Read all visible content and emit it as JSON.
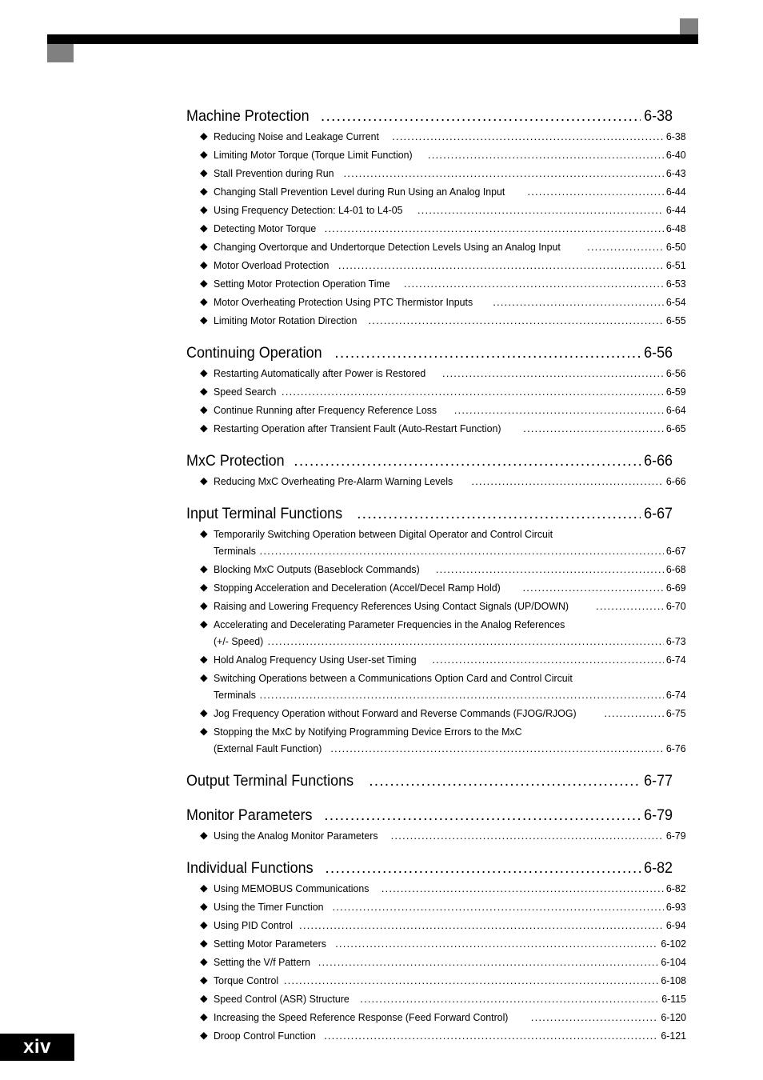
{
  "document": {
    "footer_page_label": "xiv",
    "header_bar_color": "#000000",
    "header_square_color": "#808080"
  },
  "toc": {
    "entries": [
      {
        "type": "heading",
        "title": "Machine Protection",
        "page": "6-38"
      },
      {
        "type": "item",
        "title": "Reducing Noise and Leakage Current",
        "page": "6-38"
      },
      {
        "type": "item",
        "title": "Limiting Motor Torque (Torque Limit Function)",
        "page": "6-40"
      },
      {
        "type": "item",
        "title": "Stall Prevention during Run",
        "page": "6-43"
      },
      {
        "type": "item",
        "title": "Changing Stall Prevention Level during Run Using an Analog Input",
        "page": "6-44"
      },
      {
        "type": "item",
        "title": "Using Frequency Detection: L4-01 to L4-05",
        "page": "6-44"
      },
      {
        "type": "item",
        "title": "Detecting Motor Torque",
        "page": "6-48"
      },
      {
        "type": "item",
        "title": "Changing Overtorque and Undertorque Detection Levels Using an Analog Input",
        "page": "6-50"
      },
      {
        "type": "item",
        "title": "Motor Overload Protection",
        "page": "6-51"
      },
      {
        "type": "item",
        "title": "Setting Motor Protection Operation Time",
        "page": "6-53"
      },
      {
        "type": "item",
        "title": "Motor Overheating Protection Using PTC Thermistor Inputs",
        "page": "6-54"
      },
      {
        "type": "item",
        "title": "Limiting Motor Rotation Direction",
        "page": "6-55"
      },
      {
        "type": "heading",
        "title": "Continuing Operation",
        "page": "6-56"
      },
      {
        "type": "item",
        "title": "Restarting Automatically after Power is Restored",
        "page": "6-56"
      },
      {
        "type": "item",
        "title": "Speed Search",
        "page": "6-59"
      },
      {
        "type": "item",
        "title": "Continue Running after Frequency Reference Loss",
        "page": "6-64"
      },
      {
        "type": "item",
        "title": "Restarting Operation after Transient Fault (Auto-Restart Function)",
        "page": "6-65"
      },
      {
        "type": "heading",
        "title": "MxC Protection",
        "page": "6-66"
      },
      {
        "type": "item",
        "title": "Reducing MxC Overheating Pre-Alarm Warning Levels",
        "page": "6-66"
      },
      {
        "type": "heading",
        "title": "Input Terminal Functions",
        "page": "6-67"
      },
      {
        "type": "item-wrap",
        "title": "Temporarily Switching Operation between Digital Operator and Control Circuit"
      },
      {
        "type": "cont",
        "title": "Terminals",
        "page": "6-67"
      },
      {
        "type": "item",
        "title": "Blocking MxC Outputs (Baseblock Commands)",
        "page": "6-68"
      },
      {
        "type": "item",
        "title": "Stopping Acceleration and Deceleration (Accel/Decel Ramp Hold)",
        "page": "6-69"
      },
      {
        "type": "item",
        "title": "Raising and Lowering Frequency References Using Contact Signals (UP/DOWN)",
        "page": "6-70"
      },
      {
        "type": "item-wrap",
        "title": "Accelerating and Decelerating Parameter Frequencies in the Analog References"
      },
      {
        "type": "cont",
        "title": "(+/- Speed)",
        "page": "6-73"
      },
      {
        "type": "item",
        "title": "Hold Analog Frequency Using User-set Timing",
        "page": "6-74"
      },
      {
        "type": "item-wrap",
        "title": "Switching Operations between a Communications Option Card and Control Circuit"
      },
      {
        "type": "cont",
        "title": "Terminals",
        "page": "6-74"
      },
      {
        "type": "item",
        "title": "Jog Frequency Operation without Forward and Reverse Commands (FJOG/RJOG)",
        "page": "6-75"
      },
      {
        "type": "item-wrap",
        "title": "Stopping the MxC by Notifying Programming Device Errors to the MxC"
      },
      {
        "type": "cont",
        "title": "(External Fault Function)",
        "page": "6-76"
      },
      {
        "type": "heading",
        "title": "Output Terminal Functions",
        "page": "6-77"
      },
      {
        "type": "heading",
        "title": "Monitor Parameters",
        "page": "6-79"
      },
      {
        "type": "item",
        "title": "Using the Analog Monitor Parameters",
        "page": "6-79"
      },
      {
        "type": "heading",
        "title": "Individual Functions",
        "page": "6-82"
      },
      {
        "type": "item",
        "title": "Using MEMOBUS Communications",
        "page": "6-82"
      },
      {
        "type": "item",
        "title": "Using the Timer Function",
        "page": "6-93"
      },
      {
        "type": "item",
        "title": "Using PID Control",
        "page": "6-94"
      },
      {
        "type": "item",
        "title": "Setting Motor Parameters",
        "page": "6-102"
      },
      {
        "type": "item",
        "title": "Setting the V/f Pattern",
        "page": "6-104"
      },
      {
        "type": "item",
        "title": "Torque Control",
        "page": "6-108"
      },
      {
        "type": "item",
        "title": "Speed Control (ASR) Structure",
        "page": "6-115"
      },
      {
        "type": "item",
        "title": "Increasing the Speed Reference Response (Feed Forward Control)",
        "page": "6-120"
      },
      {
        "type": "item",
        "title": "Droop Control Function",
        "page": "6-121"
      }
    ],
    "bullet_glyph": "◆"
  }
}
